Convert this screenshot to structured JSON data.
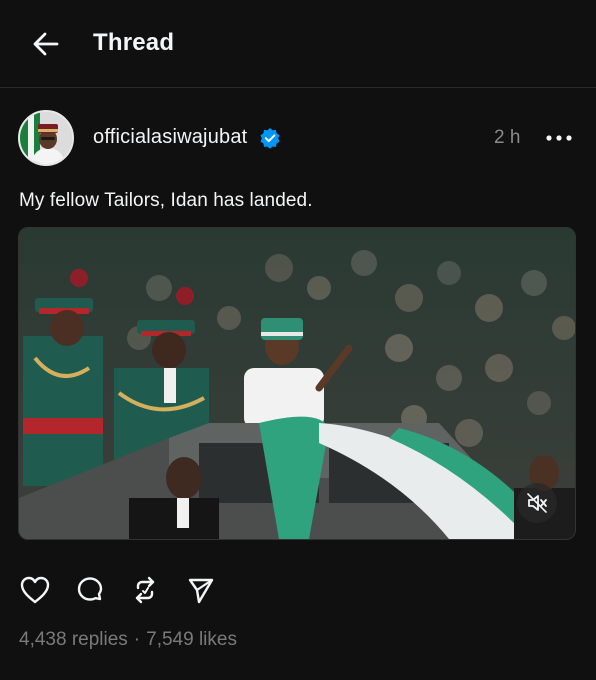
{
  "header": {
    "title": "Thread",
    "back_icon": "arrow-left-icon"
  },
  "post": {
    "username": "officialasiwajubat",
    "verified": true,
    "timestamp": "2 h",
    "caption": "My fellow Tailors, Idan has landed.",
    "media_icon": "volume-muted-icon",
    "actions": [
      "heart-icon",
      "comment-icon",
      "repost-icon",
      "share-icon"
    ],
    "stats": {
      "replies": "4,438 replies",
      "separator": "·",
      "likes": "7,549 likes"
    }
  },
  "colors": {
    "background": "#101010",
    "text": "#f3f5f7",
    "muted": "#8a8a8a",
    "verified": "#0095f6",
    "uniform_green": "#1f5c4f",
    "sash_green": "#2fa27e"
  }
}
